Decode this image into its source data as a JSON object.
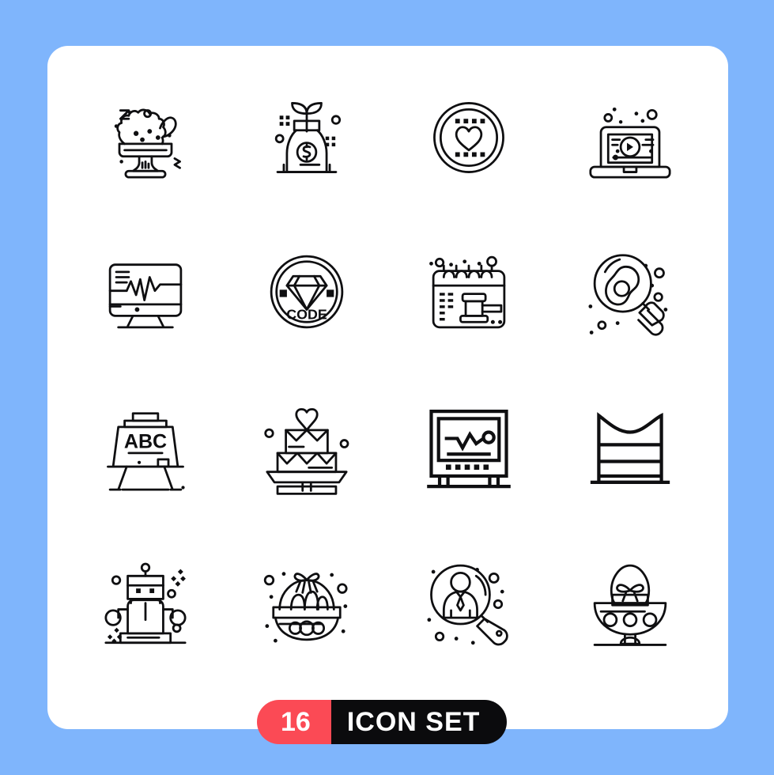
{
  "canvas": {
    "background_color": "#7fb5fc",
    "card_color": "#ffffff"
  },
  "badge": {
    "count": "16",
    "label": "ICON SET",
    "count_bg": "#fb4a55",
    "label_bg": "#0b0b0d",
    "text_color": "#ffffff"
  },
  "grid": {
    "columns": 4,
    "rows": 4,
    "stroke_color": "#0f0f11"
  },
  "icons": [
    {
      "name": "ice-cream-sundae-bowl-icon",
      "label": "Ice Cream Sundae"
    },
    {
      "name": "money-plant-jar-icon",
      "label": "Money Growth Jar"
    },
    {
      "name": "heart-coin-badge-icon",
      "label": "Heart Coin"
    },
    {
      "name": "laptop-video-play-icon",
      "label": "Video Laptop"
    },
    {
      "name": "monitor-analytics-chart-icon",
      "label": "Analytics Monitor"
    },
    {
      "name": "diamond-code-badge-icon",
      "label": "Code Badge",
      "text": "CODE"
    },
    {
      "name": "calendar-gavel-icon",
      "label": "Court Date Calendar"
    },
    {
      "name": "magnifier-egg-icon",
      "label": "Egg Search"
    },
    {
      "name": "easel-abc-board-icon",
      "label": "ABC Board",
      "text": "ABC"
    },
    {
      "name": "wedding-cake-heart-icon",
      "label": "Wedding Cake"
    },
    {
      "name": "ecg-monitor-icon",
      "label": "ECG Monitor"
    },
    {
      "name": "stacked-towels-icon",
      "label": "Stacked Layers"
    },
    {
      "name": "robot-icon",
      "label": "Robot"
    },
    {
      "name": "easter-basket-eggs-icon",
      "label": "Easter Basket"
    },
    {
      "name": "magnifier-person-search-icon",
      "label": "People Search"
    },
    {
      "name": "easter-egg-bowl-icon",
      "label": "Easter Egg Bowl"
    }
  ]
}
